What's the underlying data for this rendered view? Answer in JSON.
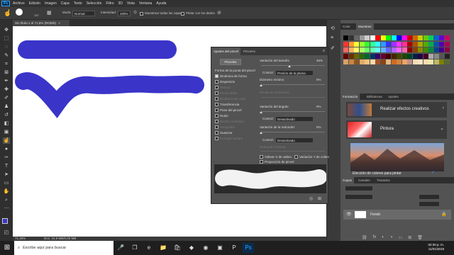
{
  "app": {
    "logo": "Ps"
  },
  "menu": [
    "Archivo",
    "Edición",
    "Imagen",
    "Capa",
    "Texto",
    "Selección",
    "Filtro",
    "3D",
    "Vista",
    "Ventana",
    "Ayuda"
  ],
  "options": {
    "brush_size": "137",
    "mode_label": "Modo:",
    "mode_value": "Normal",
    "opacity_label": "Opac.:",
    "opacity_value": "100%",
    "flow_label": "Intensidad:",
    "flow_value": "100%",
    "sample_all_label": "Muestrear todas las capas",
    "finger_paint_label": "Pintar con los dedos"
  },
  "document": {
    "tab": "Sin título-1 al 71,5% (RGB/8)",
    "zoom": "71,45%",
    "doc_info": "Doc: 24,9 MB/0,00 MB"
  },
  "right_panels": {
    "color_tabs": [
      "Color",
      "Muestras"
    ],
    "learn_tabs": [
      "Formación",
      "Bibliotecas",
      "Ajustes"
    ],
    "learn_cards": [
      {
        "title": "Realizar efectos creativos"
      },
      {
        "title": "Pintura"
      },
      {
        "title": "Elección de colores para pintar"
      }
    ],
    "layers_tabs": [
      "Capas",
      "Canales",
      "Trazados"
    ],
    "layer_name": "Fondo"
  },
  "brush_panel": {
    "tabs": [
      "Ajustes del pincel",
      "Pinceles"
    ],
    "presets_button": "Pinceles",
    "tip_shape_label": "Forma de la punta del pincel",
    "options": [
      {
        "label": "Dinámica de forma",
        "checked": true,
        "dim": false
      },
      {
        "label": "Dispersión",
        "checked": false,
        "dim": false
      },
      {
        "label": "Textura",
        "checked": false,
        "dim": true
      },
      {
        "label": "Pincel doble",
        "checked": false,
        "dim": true
      },
      {
        "label": "Dinámica de color",
        "checked": false,
        "dim": true
      },
      {
        "label": "Transferencia",
        "checked": false,
        "dim": false
      },
      {
        "label": "Pose del pincel",
        "checked": false,
        "dim": false
      },
      {
        "label": "Ruido",
        "checked": false,
        "dim": false
      },
      {
        "label": "Bordes húmedos",
        "checked": false,
        "dim": true
      },
      {
        "label": "Aerografía",
        "checked": false,
        "dim": true
      },
      {
        "label": "Suavizar",
        "checked": false,
        "dim": false
      },
      {
        "label": "Proteger textura",
        "checked": false,
        "dim": true
      }
    ],
    "size_jitter_label": "Variación del tamaño",
    "size_jitter_value": "45%",
    "control_label": "Control:",
    "control_pressure": "Presión de la pluma",
    "min_diameter_label": "Diámetro mínimo",
    "min_diameter_value": "0%",
    "tilt_scale_label": "Escala de inclinación",
    "angle_jitter_label": "Variación del ángulo",
    "angle_jitter_value": "0%",
    "control_off": "Desactivado",
    "roundness_jitter_label": "Variación de la redondez",
    "roundness_jitter_value": "0%",
    "min_roundness_label": "Redondez mínima",
    "flip_x_label": "Voltear X de vaibro",
    "flip_y_label": "Variación Y de volteo",
    "projection_label": "Proyección de pincel"
  },
  "taskbar": {
    "search_placeholder": "Escribe aquí para buscar",
    "time": "02:30 p. m.",
    "date": "11/01/2019"
  },
  "colors": {
    "stroke": "#3a34c9",
    "ui_dark": "#323232",
    "accent": "#31a8ff"
  }
}
